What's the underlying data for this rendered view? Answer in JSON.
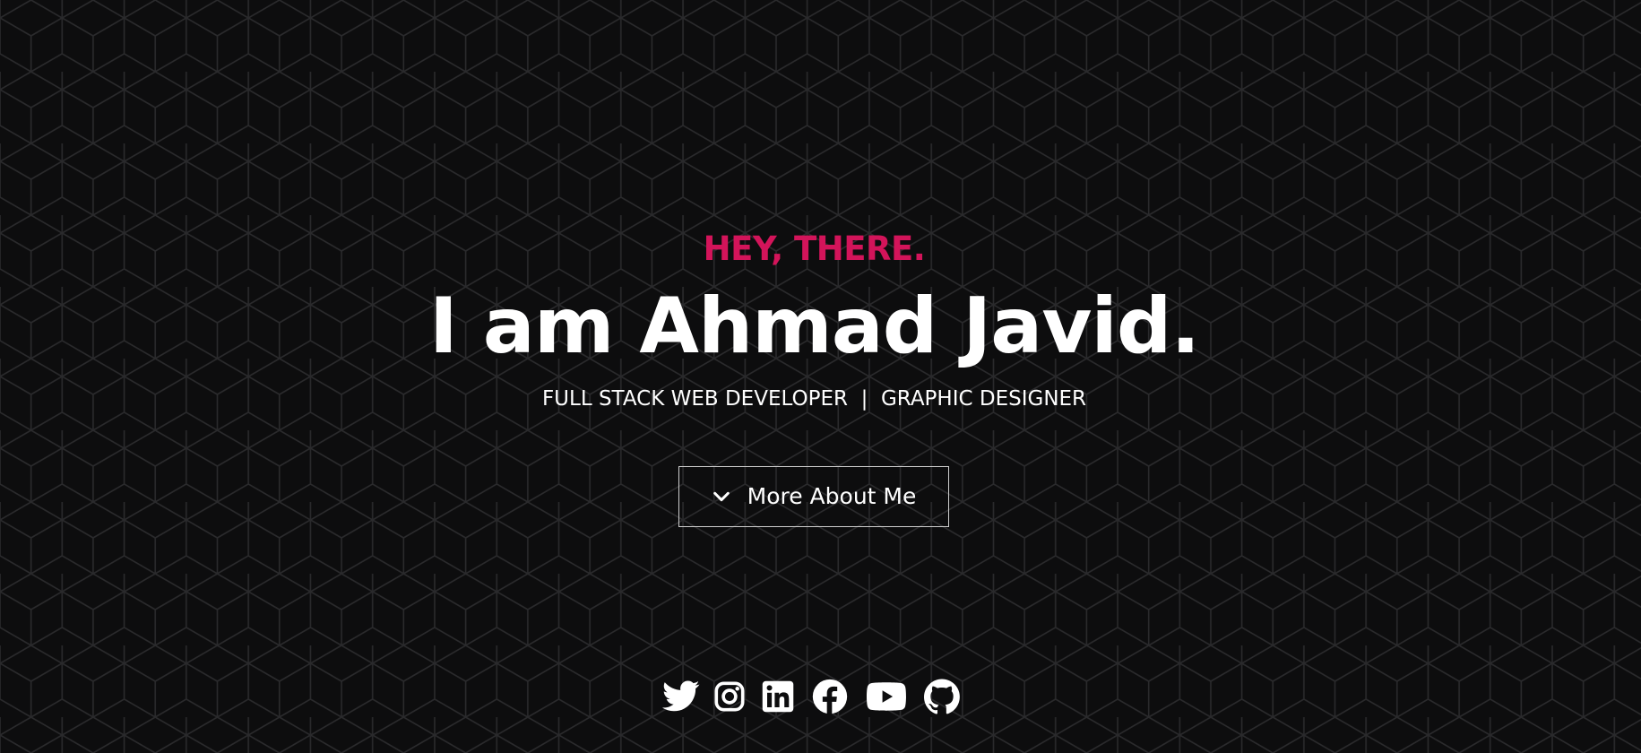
{
  "hero": {
    "greeting": "HEY, THERE.",
    "headline": "I am Ahmad Javid.",
    "roles": "FULL STACK WEB DEVELOPER  |  GRAPHIC DESIGNER",
    "more_button": {
      "label": "More About Me",
      "icon": "chevron-down-icon"
    }
  },
  "socials": [
    {
      "icon": "twitter-icon"
    },
    {
      "icon": "instagram-icon"
    },
    {
      "icon": "linkedin-icon"
    },
    {
      "icon": "facebook-icon"
    },
    {
      "icon": "youtube-icon"
    },
    {
      "icon": "github-icon"
    }
  ],
  "colors": {
    "background": "#0d0d0e",
    "pattern_line": "#2a2a2c",
    "accent": "#d3145a",
    "text": "#ffffff"
  }
}
